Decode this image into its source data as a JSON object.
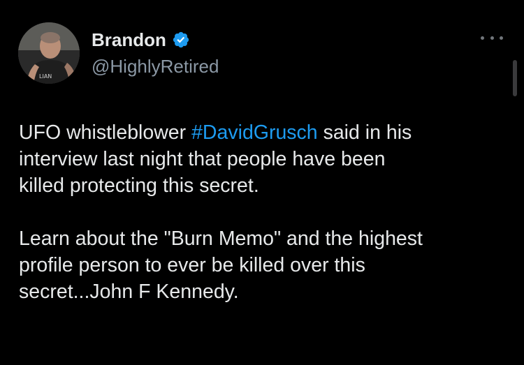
{
  "author": {
    "display_name": "Brandon",
    "handle": "@HighlyRetired",
    "verified": true,
    "avatar_shirt_text": "LIAN"
  },
  "post": {
    "paragraph1": {
      "line1_prefix": "UFO whistleblower ",
      "hashtag": "#DavidGrusch",
      "line1_suffix": " said in his",
      "line2": "interview last night that people have been",
      "line3": "killed protecting this secret."
    },
    "paragraph2": {
      "line1": "Learn about the \"Burn Memo\" and the highest",
      "line2": "profile person to ever be killed over this",
      "line3": "secret...John F Kennedy."
    }
  },
  "colors": {
    "background": "#000000",
    "text": "#e7e9ea",
    "secondary_text": "#8b98a5",
    "link": "#1d9bf0",
    "verified_badge": "#1d9bf0"
  },
  "icons": {
    "verified": "verified-badge-icon",
    "more": "more-horizontal-icon"
  }
}
